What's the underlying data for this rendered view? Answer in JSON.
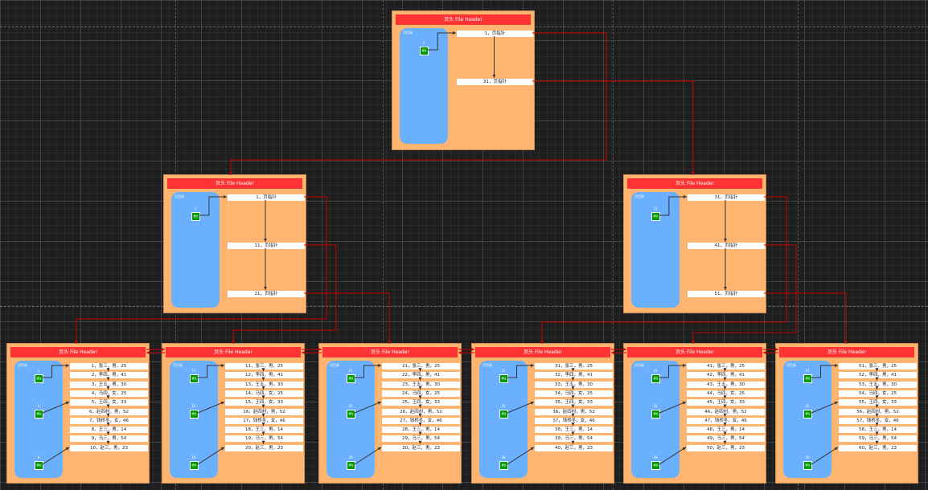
{
  "header_title": "页头 File Header",
  "directory_label": "页目录",
  "slot_label": "槽位",
  "root_page": {
    "directory_slots": [
      {
        "number": "1"
      }
    ],
    "records": [
      "1，页指针",
      "31，页指针"
    ]
  },
  "middle_pages": [
    {
      "directory_slots": [
        {
          "number": "1"
        }
      ],
      "records": [
        "1，页指针",
        "11，页指针",
        "21，页指针"
      ]
    },
    {
      "directory_slots": [
        {
          "number": "31"
        }
      ],
      "records": [
        "31，页指针",
        "41，页指针",
        "51，页指针"
      ]
    }
  ],
  "leaf_pages": [
    {
      "directory_slots": [
        {
          "number": "1"
        },
        {
          "number": "5"
        },
        {
          "number": "9"
        }
      ],
      "records": [
        "1，张三，男，25",
        "2，李四，男，41",
        "3，王五，男，30",
        "4，马四，女，25",
        "5，王四，女，33",
        "6，赵四村，男，52",
        "7，钱桥冬，女，46",
        "8，王三，男，14",
        "9，马三，男，54",
        "10，赵三，男，23"
      ]
    },
    {
      "directory_slots": [
        {
          "number": "11"
        },
        {
          "number": "15"
        },
        {
          "number": "19"
        }
      ],
      "records": [
        "11，张三，男，25",
        "12，李四，男，41",
        "13，王五，男，30",
        "14，马四，女，25",
        "15，王四，女，33",
        "16，赵四村，男，52",
        "17，钱桥冬，女，46",
        "18，王三，男，14",
        "19，马三，男，54",
        "20，赵三，男，23"
      ]
    },
    {
      "directory_slots": [
        {
          "number": "21"
        },
        {
          "number": "25"
        },
        {
          "number": "29"
        }
      ],
      "records": [
        "21，张三，男，25",
        "22，李四，男，41",
        "23，王五，男，30",
        "24，马四，女，25",
        "25，王四，女，33",
        "26，赵四村，男，52",
        "27，钱桥冬，女，46",
        "28，王三，男，14",
        "29，马三，男，54",
        "30，赵三，男，23"
      ]
    },
    {
      "directory_slots": [
        {
          "number": "31"
        },
        {
          "number": "35"
        },
        {
          "number": "39"
        }
      ],
      "records": [
        "31，张三，男，25",
        "32，李四，男，41",
        "33，王五，男，30",
        "34，马四，女，25",
        "35，王四，女，33",
        "36，赵四村，男，52",
        "37，钱桥冬，女，46",
        "38，王三，男，14",
        "39，马三，男，54",
        "40，赵三，男，23"
      ]
    },
    {
      "directory_slots": [
        {
          "number": "41"
        },
        {
          "number": "45"
        },
        {
          "number": "49"
        }
      ],
      "records": [
        "41，张三，男，25",
        "42，李四，男，41",
        "43，王五，男，30",
        "44，马四，女，25",
        "45，王四，女，33",
        "46，赵四村，男，52",
        "47，钱桥冬，女，46",
        "48，王三，男，14",
        "49，马三，男，54",
        "50，赵三，男，23"
      ]
    },
    {
      "directory_slots": [
        {
          "number": "51"
        },
        {
          "number": "55"
        },
        {
          "number": "59"
        }
      ],
      "records": [
        "51，张三，男，25",
        "52，李四，男，41",
        "53，王五，男，30",
        "54，马四，女，25",
        "55，王四，女，33",
        "56，赵四村，男，52",
        "57，钱桥冬，女，46",
        "58，王三，男，14",
        "59，马三，男，54",
        "60，赵三，男，23"
      ]
    }
  ],
  "colors": {
    "canvas_bg": "#1e1e1e",
    "page_bg": "#ffb570",
    "header_bg": "#ff3333",
    "directory_bg": "#6ab0ff",
    "slot_bg": "#009900",
    "pointer_line": "#cc0000",
    "record_chain_line": "#333333"
  }
}
